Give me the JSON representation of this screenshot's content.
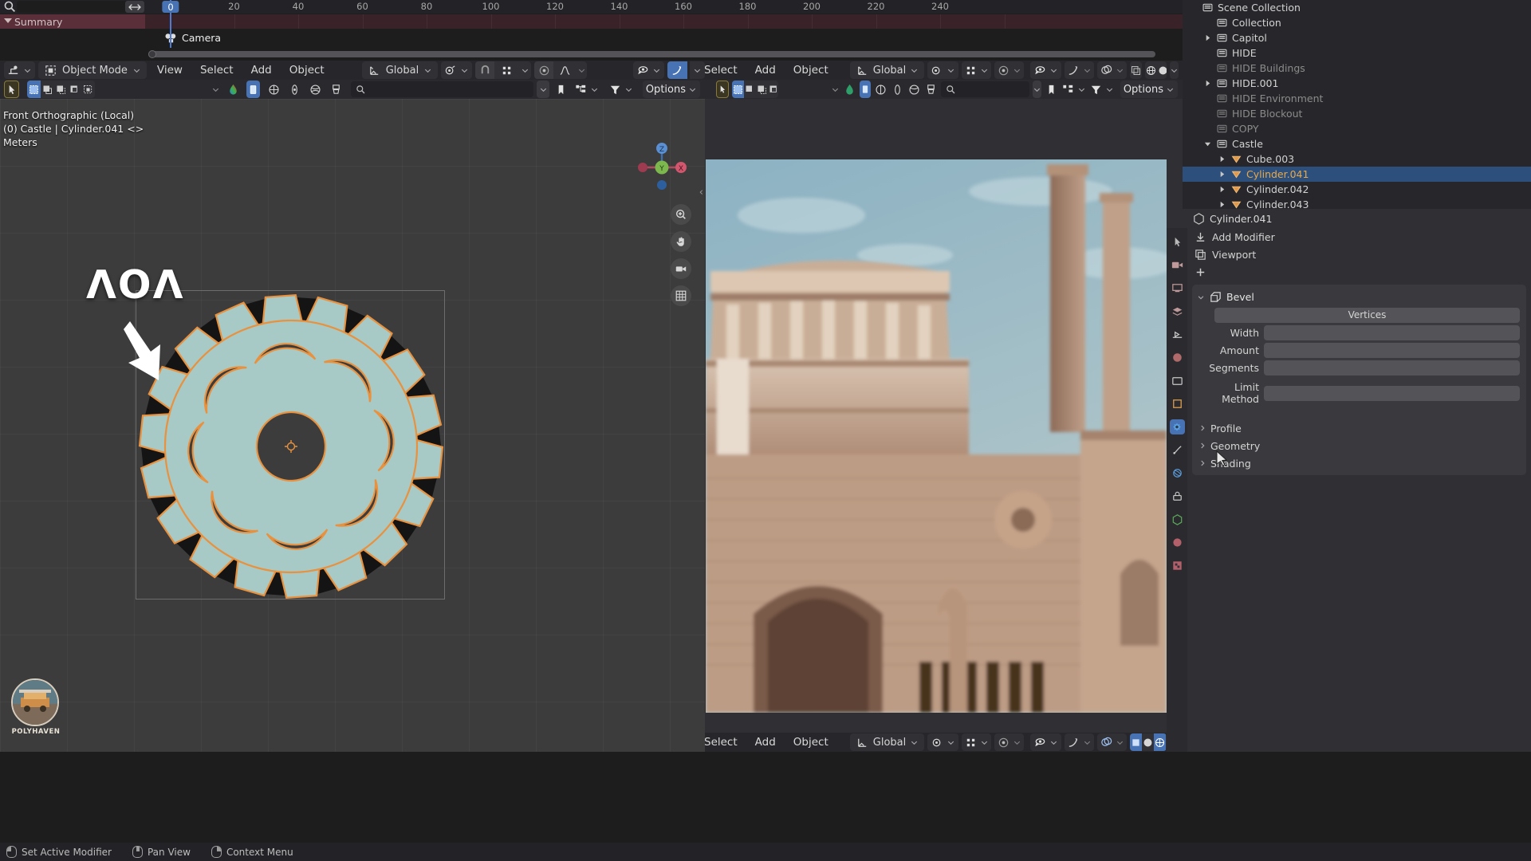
{
  "app": {
    "name": "Blender"
  },
  "timeline": {
    "search_placeholder": "",
    "summary_label": "Summary",
    "current_frame": "0",
    "channel_name": "Camera",
    "ruler_ticks": [
      "0",
      "20",
      "40",
      "60",
      "80",
      "100",
      "120",
      "140",
      "160",
      "180",
      "200",
      "220",
      "240"
    ],
    "icons": {
      "search": "search-icon",
      "resize": "horizontal-resize-icon",
      "keyframe": "keyframe-diamond-icon"
    }
  },
  "viewport_left": {
    "header": {
      "editor_type": "editor-type-3d-viewport-icon",
      "mode": "Object Mode",
      "menus": [
        "View",
        "Select",
        "Add",
        "Object"
      ],
      "transform_orientation": "Global",
      "snap_icon": "magnet-icon",
      "pivot_icon": "pivot-point-icon",
      "proportional_icon": "proportional-edit-icon",
      "falloff_icon": "falloff-curve-icon",
      "visibility_icon": "object-types-visibility-icon",
      "gizmo_icon": "gizmo-icon",
      "overlays_icon": "overlays-icon",
      "xray_icon": "x-ray-toggle-icon",
      "shading": [
        "wireframe",
        "solid",
        "material-preview",
        "rendered"
      ],
      "shading_active": "material-preview"
    },
    "tool_settings": {
      "active_tool": "tweak-tool-icon",
      "select_modes": [
        "set",
        "extend",
        "subtract",
        "invert",
        "intersect"
      ],
      "select_mode_active": "set",
      "mode_icons": [
        "color-gradient-icon",
        "object-mode-icon",
        "world-icon",
        "physics-icon",
        "global-icon",
        "brush-icon"
      ],
      "search_placeholder": "",
      "filter_icons": [
        "bookmark-icon",
        "hierarchy-icon",
        "filter-funnel-icon"
      ],
      "options_label": "Options"
    },
    "overlay": {
      "view_name": "Front Orthographic (Local)",
      "object_info": "(0) Castle | Cylinder.041 <>",
      "units": "Meters"
    },
    "annotation": {
      "text": "ΛΟΛ",
      "arrow": "arrow-down-left-icon"
    },
    "gizmo": {
      "axes": [
        "Z",
        "Y",
        "X"
      ]
    },
    "nav_tools": [
      "zoom-icon",
      "pan-hand-icon",
      "camera-view-icon",
      "toggle-ortho-grid-icon"
    ],
    "watermark": {
      "brand": "POLYHAVEN"
    },
    "object": {
      "name": "Cylinder.041",
      "fill_color": "#a8cac6",
      "outline_color": "#e8913f",
      "teeth": 18,
      "holes": 8
    }
  },
  "viewport_right": {
    "header": {
      "menus": [
        "Select",
        "Add",
        "Object"
      ],
      "transform_orientation": "Global",
      "options_label": "Options"
    },
    "footer": {
      "menus": [
        "Select",
        "Add",
        "Object"
      ],
      "transform_orientation": "Global"
    },
    "content": "rendered-castle-capitol-image"
  },
  "outliner": {
    "rows": [
      {
        "label": "Scene Collection",
        "indent": 0,
        "icon": "collection-icon",
        "expand": "none",
        "state": "normal"
      },
      {
        "label": "Collection",
        "indent": 1,
        "icon": "collection-icon",
        "expand": "none",
        "state": "normal"
      },
      {
        "label": "Capitol",
        "indent": 1,
        "icon": "collection-icon",
        "expand": "closed",
        "state": "normal"
      },
      {
        "label": "HIDE",
        "indent": 1,
        "icon": "collection-icon",
        "expand": "none",
        "state": "normal"
      },
      {
        "label": "HIDE Buildings",
        "indent": 1,
        "icon": "collection-icon",
        "expand": "none",
        "state": "dim"
      },
      {
        "label": "HIDE.001",
        "indent": 1,
        "icon": "collection-icon",
        "expand": "closed",
        "state": "normal"
      },
      {
        "label": "HIDE Environment",
        "indent": 1,
        "icon": "collection-icon",
        "expand": "none",
        "state": "dim"
      },
      {
        "label": "HIDE Blockout",
        "indent": 1,
        "icon": "collection-icon",
        "expand": "none",
        "state": "dim"
      },
      {
        "label": "COPY",
        "indent": 1,
        "icon": "collection-icon",
        "expand": "none",
        "state": "dim"
      },
      {
        "label": "Castle",
        "indent": 1,
        "icon": "collection-icon",
        "expand": "open",
        "state": "normal"
      },
      {
        "label": "Cube.003",
        "indent": 2,
        "icon": "mesh-data-icon",
        "expand": "closed",
        "state": "normal"
      },
      {
        "label": "Cylinder.041",
        "indent": 2,
        "icon": "mesh-data-icon",
        "expand": "closed",
        "state": "active"
      },
      {
        "label": "Cylinder.042",
        "indent": 2,
        "icon": "mesh-data-icon",
        "expand": "closed",
        "state": "normal"
      },
      {
        "label": "Cylinder.043",
        "indent": 2,
        "icon": "mesh-data-icon",
        "expand": "closed",
        "state": "normal"
      }
    ]
  },
  "properties": {
    "breadcrumb_object": "Cylinder.041",
    "tabs": [
      "tool-icon",
      "render-icon",
      "output-icon",
      "view-layer-icon",
      "scene-icon",
      "world-icon",
      "collection-icon",
      "object-icon",
      "modifier-icon",
      "particles-icon",
      "physics-icon",
      "constraints-icon",
      "data-icon",
      "material-icon",
      "texture-icon"
    ],
    "active_tab": "modifier-icon",
    "buttons": {
      "add_modifier": "Add Modifier",
      "copy_from": "Viewport"
    },
    "modifier": {
      "name": "Bevel",
      "icon": "bevel-modifier-icon",
      "fields": [
        {
          "label": "",
          "value": "Vertices"
        },
        {
          "label": "Width",
          "value": ""
        },
        {
          "label": "Amount",
          "value": ""
        },
        {
          "label": "Segments",
          "value": ""
        },
        {
          "label": "Limit Method",
          "value": ""
        }
      ],
      "sections": [
        "Profile",
        "Geometry",
        "Shading"
      ]
    }
  },
  "status_bar": {
    "items": [
      {
        "mouse": "left-mouse-icon",
        "label": "Set Active Modifier"
      },
      {
        "mouse": "middle-mouse-icon",
        "label": "Pan View"
      },
      {
        "mouse": "right-mouse-icon",
        "label": "Context Menu"
      }
    ]
  },
  "colors": {
    "accent_blue": "#4772b3",
    "selection_orange": "#e8913f",
    "gear_fill": "#a8cac6",
    "summary_red": "#5b2f39",
    "active_text": "#e9a94a"
  }
}
